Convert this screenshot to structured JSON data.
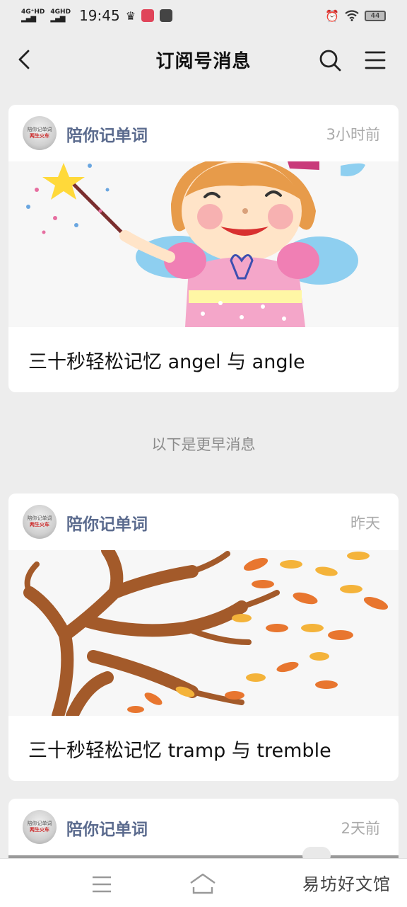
{
  "status_bar": {
    "net1": "4G⁺HD",
    "net2": "4GHD",
    "time": "19:45",
    "battery": "44"
  },
  "header": {
    "title": "订阅号消息"
  },
  "messages": [
    {
      "account": "陪你记单词",
      "time": "3小时前",
      "title": "三十秒轻松记忆 angel 与 angle",
      "avatar_top": "陪你记单词",
      "avatar_bottom": "两生火车"
    },
    {
      "account": "陪你记单词",
      "time": "昨天",
      "title": "三十秒轻松记忆 tramp 与 tremble",
      "avatar_top": "陪你记单词",
      "avatar_bottom": "两生火车"
    },
    {
      "account": "陪你记单词",
      "time": "2天前",
      "avatar_top": "陪你记单词",
      "avatar_bottom": "两生火车"
    }
  ],
  "divider": "以下是更早消息",
  "watermark": "易坊好文馆",
  "colors": {
    "background": "#ededed",
    "account_name": "#5b6b8e",
    "timestamp": "#aaaaaa"
  }
}
